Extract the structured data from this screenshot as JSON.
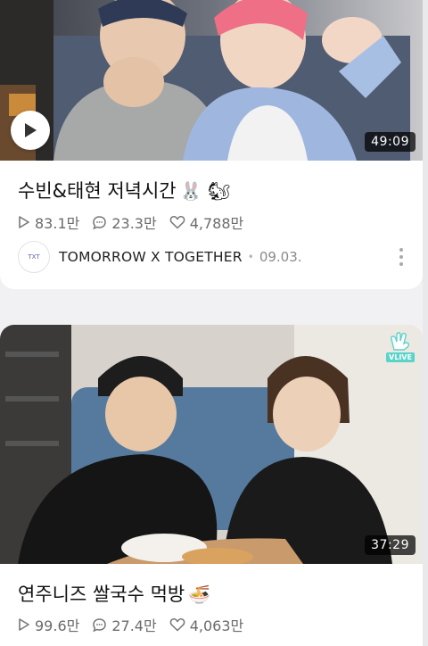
{
  "cards": [
    {
      "title": "수빈&태현 저녁시간",
      "title_emoji": "🐰 🐿",
      "duration": "49:09",
      "stats": {
        "views": "83.1만",
        "comments": "23.3만",
        "likes": "4,788만"
      },
      "channel": {
        "name": "TOMORROW X TOGETHER",
        "date": "09.03.",
        "avatar_text": "TXT"
      },
      "icons": [
        "play-icon",
        "more-vertical-icon"
      ]
    },
    {
      "title": "연주니즈 쌀국수 먹방",
      "title_emoji": "🍜",
      "duration": "37:29",
      "badge": "VLIVE",
      "stats": {
        "views": "99.6만",
        "comments": "27.4만",
        "likes": "4,063만"
      },
      "icons": [
        "vlive-logo-icon"
      ]
    }
  ],
  "colors": {
    "background": "#f1f1f3",
    "card": "#ffffff",
    "meta_text": "#6b6b6b",
    "vlive_accent": "#5ad3c8"
  }
}
